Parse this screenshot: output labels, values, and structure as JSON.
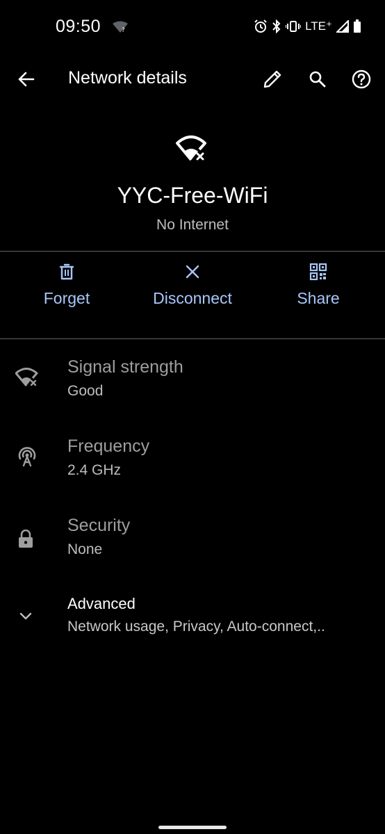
{
  "status_bar": {
    "time": "09:50",
    "network_type": "LTE⁺"
  },
  "app_bar": {
    "title": "Network details"
  },
  "network": {
    "name": "YYC-Free-WiFi",
    "status": "No Internet"
  },
  "actions": [
    {
      "label": "Forget",
      "icon": "trash-icon"
    },
    {
      "label": "Disconnect",
      "icon": "close-icon"
    },
    {
      "label": "Share",
      "icon": "qr-code-icon"
    }
  ],
  "details": [
    {
      "title": "Signal strength",
      "value": "Good",
      "icon": "wifi-no-internet-icon"
    },
    {
      "title": "Frequency",
      "value": "2.4 GHz",
      "icon": "antenna-icon"
    },
    {
      "title": "Security",
      "value": "None",
      "icon": "lock-icon"
    },
    {
      "title": "Advanced",
      "value": "Network usage, Privacy, Auto-connect,..",
      "icon": "chevron-down-icon"
    }
  ],
  "colors": {
    "background": "#000000",
    "accent": "#a8c7fa",
    "divider": "#5f6368",
    "secondary_text": "#bdbdbd"
  }
}
